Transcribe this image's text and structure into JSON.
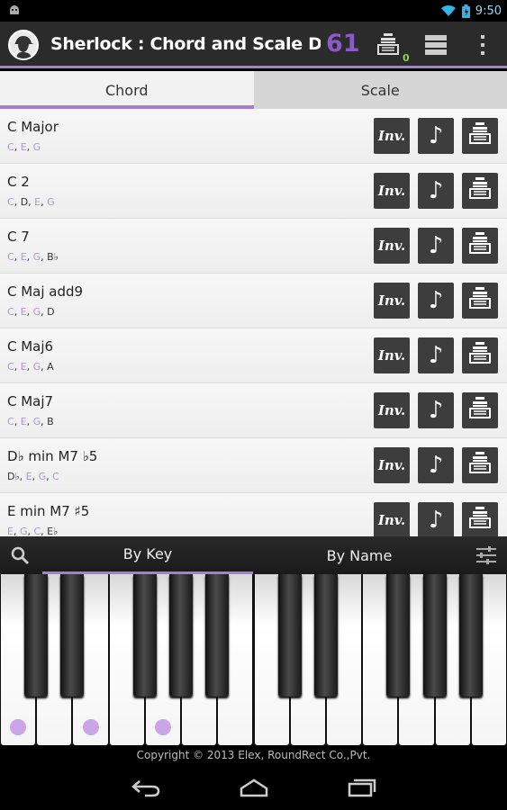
{
  "status_bar": {
    "time": "9:50",
    "icons": [
      "android-debug-icon",
      "wifi-icon",
      "battery-icon"
    ]
  },
  "action_bar": {
    "title": "Sherlock : Chord and Scale Det...",
    "count": "61",
    "badge": "0",
    "icons": [
      "sherlock-app-icon",
      "chord-stack-icon",
      "list-icon",
      "overflow-menu-icon"
    ],
    "accent_color": "#a77ed6"
  },
  "tabs": [
    {
      "label": "Chord",
      "active": true
    },
    {
      "label": "Scale",
      "active": false
    }
  ],
  "chords": [
    {
      "name": "C Major",
      "notes": [
        {
          "t": "C",
          "hl": true
        },
        {
          "t": "E",
          "hl": true
        },
        {
          "t": "G",
          "hl": true
        }
      ]
    },
    {
      "name": "C 2",
      "notes": [
        {
          "t": "C",
          "hl": true
        },
        {
          "t": "D",
          "hl": false
        },
        {
          "t": "E",
          "hl": true
        },
        {
          "t": "G",
          "hl": true
        }
      ]
    },
    {
      "name": "C 7",
      "notes": [
        {
          "t": "C",
          "hl": true
        },
        {
          "t": "E",
          "hl": true
        },
        {
          "t": "G",
          "hl": true
        },
        {
          "t": "B♭",
          "hl": false
        }
      ]
    },
    {
      "name": "C Maj add9",
      "notes": [
        {
          "t": "C",
          "hl": true
        },
        {
          "t": "E",
          "hl": true
        },
        {
          "t": "G",
          "hl": true
        },
        {
          "t": "D",
          "hl": false
        }
      ]
    },
    {
      "name": "C Maj6",
      "notes": [
        {
          "t": "C",
          "hl": true
        },
        {
          "t": "E",
          "hl": true
        },
        {
          "t": "G",
          "hl": true
        },
        {
          "t": "A",
          "hl": false
        }
      ]
    },
    {
      "name": "C Maj7",
      "notes": [
        {
          "t": "C",
          "hl": true
        },
        {
          "t": "E",
          "hl": true
        },
        {
          "t": "G",
          "hl": true
        },
        {
          "t": "B",
          "hl": false
        }
      ]
    },
    {
      "name": "D♭ min M7 ♭5",
      "notes": [
        {
          "t": "D♭",
          "hl": false
        },
        {
          "t": "E",
          "hl": true
        },
        {
          "t": "G",
          "hl": true
        },
        {
          "t": "C",
          "hl": true
        }
      ]
    },
    {
      "name": "E min M7 ♯5",
      "notes": [
        {
          "t": "E",
          "hl": true
        },
        {
          "t": "G",
          "hl": true
        },
        {
          "t": "C",
          "hl": true
        },
        {
          "t": "E♭",
          "hl": false
        }
      ]
    }
  ],
  "row_buttons": {
    "inv_label": "Inv.",
    "play_symbol": "♪"
  },
  "piano": {
    "tabs": [
      {
        "label": "By Key",
        "active": true
      },
      {
        "label": "By Name",
        "active": false
      }
    ],
    "pressed_keys": [
      "C",
      "E",
      "G"
    ],
    "dot_color": "#c9a6e8"
  },
  "footer": {
    "copyright": "Copyright © 2013 Elex, RoundRect Co.,Pvt."
  },
  "nav_bar": {
    "icons": [
      "back-icon",
      "home-icon",
      "recent-apps-icon"
    ]
  }
}
